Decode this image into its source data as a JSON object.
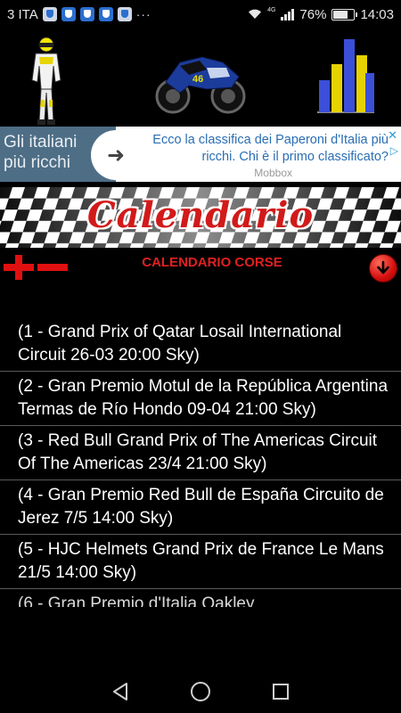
{
  "status_bar": {
    "carrier": "3 ITA",
    "overflow": "···",
    "net_tag": "4G",
    "battery_percent_text": "76%",
    "battery_level": 0.76,
    "time": "14:03"
  },
  "ad": {
    "left_text": "Gli italiani più ricchi",
    "headline": "Ecco la classifica dei Paperoni d'Italia più ricchi. Chi è il primo classificato?",
    "source": "Mobbox",
    "icons": [
      "arrow-right-icon",
      "close-icon",
      "ad-choices-icon"
    ]
  },
  "banner": {
    "title": "Calendario"
  },
  "toolbar": {
    "title": "CALENDARIO CORSE"
  },
  "races": [
    "(1 - Grand Prix of Qatar Losail International Circuit 26-03 20:00 Sky)",
    "(2 - Gran Premio Motul de la República Argentina Termas de Río Hondo 09-04 21:00 Sky)",
    "(3 - Red Bull Grand Prix of The Americas Circuit Of The Americas 23/4 21:00 Sky)",
    "(4 - Gran Premio Red Bull de España Circuito de Jerez 7/5 14:00 Sky)",
    "(5 - HJC Helmets Grand Prix de France Le Mans 21/5 14:00 Sky)",
    "(6 - Gran Premio d'Italia Oakley"
  ],
  "colors": {
    "accent_red": "#e02020",
    "ad_blue": "#4e6e86",
    "ad_link": "#2a6eb4"
  }
}
